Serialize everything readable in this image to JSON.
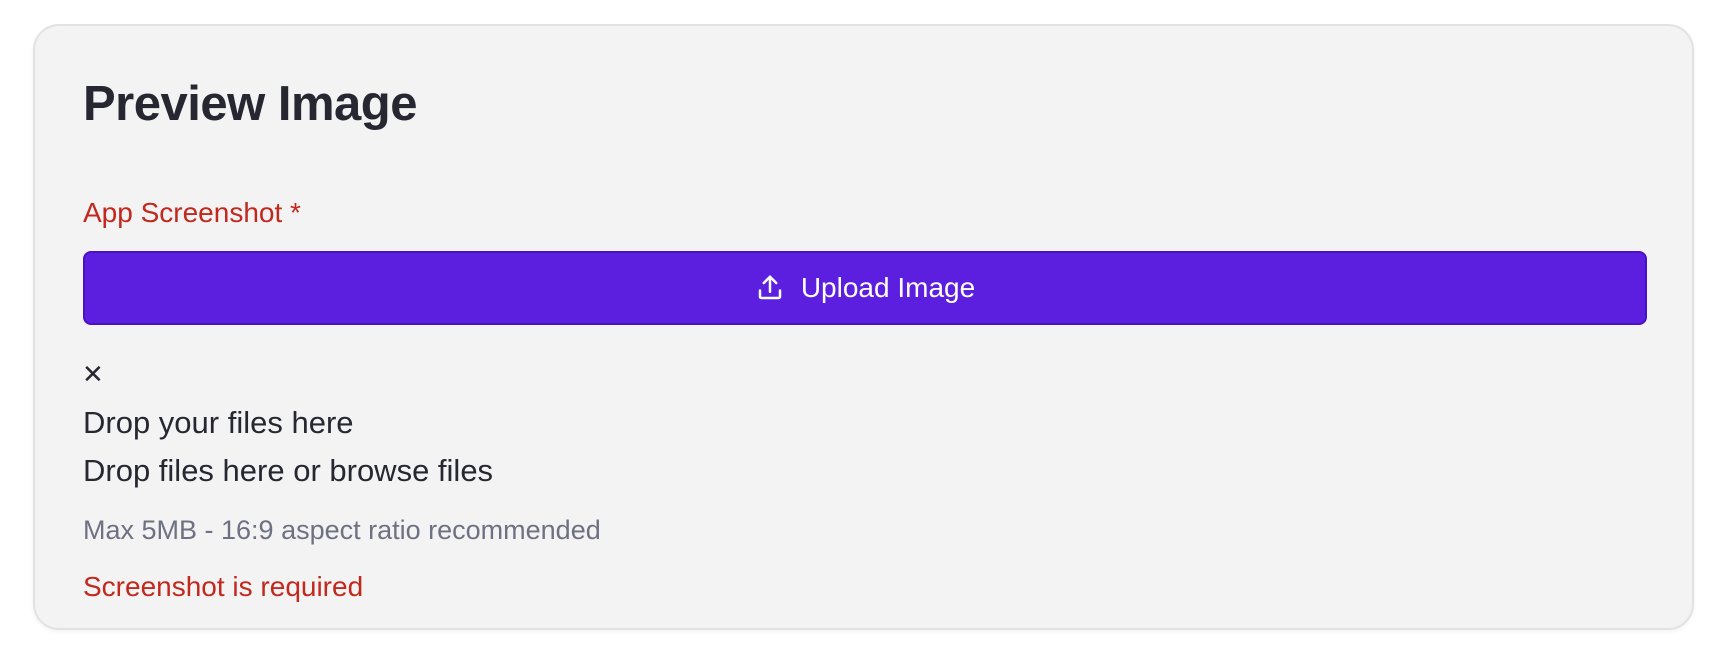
{
  "card": {
    "title": "Preview Image"
  },
  "field": {
    "label": "App Screenshot *"
  },
  "upload": {
    "label": "Upload Image",
    "icon": "upload-icon"
  },
  "dropzone": {
    "close_glyph": "✕",
    "title": "Drop your files here",
    "subtitle": "Drop files here or browse files"
  },
  "hint": "Max 5MB - 16:9 aspect ratio recommended",
  "error": "Screenshot is required",
  "colors": {
    "accent": "#5c1fe0",
    "error": "#c2281d",
    "card_bg": "#f3f3f4",
    "muted_text": "#6e7181"
  }
}
